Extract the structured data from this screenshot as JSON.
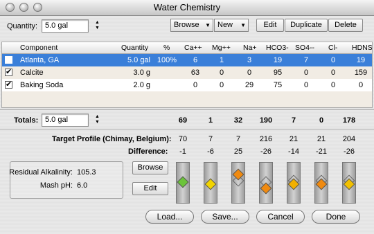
{
  "window": {
    "title": "Water Chemistry"
  },
  "toolbar": {
    "quantity_label": "Quantity:",
    "quantity_value": "5.0 gal",
    "browse_label": "Browse",
    "new_label": "New",
    "edit_label": "Edit",
    "duplicate_label": "Duplicate",
    "delete_label": "Delete"
  },
  "table": {
    "columns": [
      "Component",
      "Quantity",
      "%",
      "Ca++",
      "Mg++",
      "Na+",
      "HCO3-",
      "SO4--",
      "Cl-",
      "HDNS"
    ],
    "rows": [
      {
        "checked": true,
        "component": "Atlanta, GA",
        "quantity": "5.0 gal",
        "pct": "100%",
        "ca": "6",
        "mg": "1",
        "na": "3",
        "hco3": "19",
        "so4": "7",
        "cl": "0",
        "hdns": "19"
      },
      {
        "checked": true,
        "component": "Calcite",
        "quantity": "3.0 g",
        "pct": "",
        "ca": "63",
        "mg": "0",
        "na": "0",
        "hco3": "95",
        "so4": "0",
        "cl": "0",
        "hdns": "159"
      },
      {
        "checked": true,
        "component": "Baking Soda",
        "quantity": "2.0 g",
        "pct": "",
        "ca": "0",
        "mg": "0",
        "na": "29",
        "hco3": "75",
        "so4": "0",
        "cl": "0",
        "hdns": "0"
      }
    ]
  },
  "totals": {
    "label": "Totals:",
    "quantity": "5.0 gal",
    "values": [
      "69",
      "1",
      "32",
      "190",
      "7",
      "0",
      "178"
    ]
  },
  "target": {
    "label": "Target Profile (Chimay, Belgium):",
    "values": [
      "70",
      "7",
      "7",
      "216",
      "21",
      "21",
      "204"
    ]
  },
  "difference": {
    "label": "Difference:",
    "values": [
      "-1",
      "-6",
      "25",
      "-26",
      "-14",
      "-21",
      "-26"
    ]
  },
  "residual": {
    "alkalinity_label": "Residual Alkalinity:",
    "alkalinity_value": "105.3",
    "mash_ph_label": "Mash pH:",
    "mash_ph_value": "6.0"
  },
  "side_buttons": {
    "browse_label": "Browse",
    "edit_label": "Edit"
  },
  "sliders": [
    {
      "ion": "Ca++",
      "color": "#6cc43a",
      "level": 0.52,
      "ghost": null
    },
    {
      "ion": "Mg++",
      "color": "#f2d400",
      "level": 0.45,
      "ghost": null
    },
    {
      "ion": "Na+",
      "color": "#f08a10",
      "level": 0.78,
      "ghost": 0.57
    },
    {
      "ion": "HCO3-",
      "color": "#f08a10",
      "level": 0.3,
      "ghost": 0.52
    },
    {
      "ion": "SO4--",
      "color": "#f2b000",
      "level": 0.45,
      "ghost": 0.57
    },
    {
      "ion": "Cl-",
      "color": "#f08a10",
      "level": 0.45,
      "ghost": 0.57
    },
    {
      "ion": "HDNS",
      "color": "#f2c000",
      "level": 0.45,
      "ghost": 0.57
    }
  ],
  "footer": {
    "load_label": "Load...",
    "save_label": "Save...",
    "cancel_label": "Cancel",
    "done_label": "Done"
  },
  "colors": {
    "selection": "#3a7fd9",
    "row_alt": "#f1ece4"
  }
}
